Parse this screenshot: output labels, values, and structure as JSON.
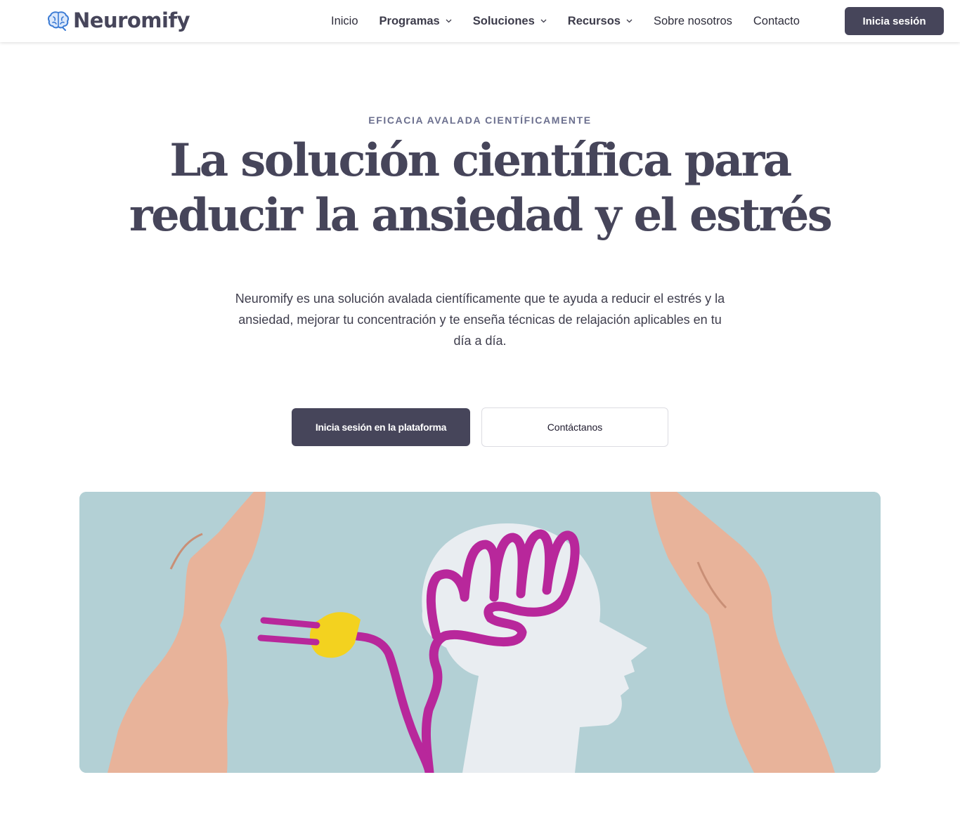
{
  "brand": {
    "name": "Neuromify",
    "logo_icon": "brain-icon",
    "accent": "#3b7bd4"
  },
  "nav": {
    "items": [
      {
        "label": "Inicio",
        "dropdown": false
      },
      {
        "label": "Programas",
        "dropdown": true
      },
      {
        "label": "Soluciones",
        "dropdown": true
      },
      {
        "label": "Recursos",
        "dropdown": true
      },
      {
        "label": "Sobre nosotros",
        "dropdown": false
      },
      {
        "label": "Contacto",
        "dropdown": false
      }
    ],
    "login_label": "Inicia sesión"
  },
  "hero": {
    "eyebrow": "EFICACIA AVALADA CIENTÍFICAMENTE",
    "headline_line1": "La solución científica para",
    "headline_line2": "reducir la ansiedad y el estrés",
    "intro": "Neuromify es una solución avalada científicamente que te ayuda a reducir el estrés y la ansiedad, mejorar tu concentración y te enseña técnicas de relajación aplicables en tu día a día.",
    "cta_primary": "Inicia sesión en la plataforma",
    "cta_secondary": "Contáctanos"
  },
  "colors": {
    "primary_dark": "#46455a",
    "eyebrow": "#6b6f8e",
    "image_background": "#b3d0d5"
  }
}
